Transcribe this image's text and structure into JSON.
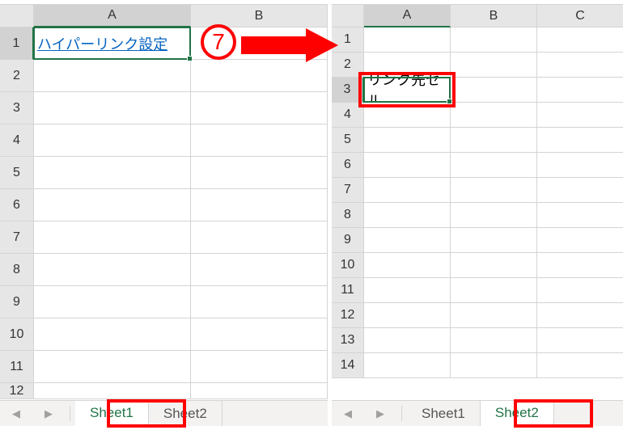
{
  "left": {
    "columns": [
      "A",
      "B"
    ],
    "rows": [
      "1",
      "2",
      "3",
      "4",
      "5",
      "6",
      "7",
      "8",
      "9",
      "10",
      "11",
      "12"
    ],
    "selected_row_idx": 0,
    "selected_col_idx": 0,
    "cells": {
      "r0c0": "ハイパーリンク設定"
    },
    "tabs": [
      {
        "label": "Sheet1",
        "active": true
      },
      {
        "label": "Sheet2",
        "active": false
      }
    ]
  },
  "right": {
    "columns": [
      "A",
      "B",
      "C"
    ],
    "rows": [
      "1",
      "2",
      "3",
      "4",
      "5",
      "6",
      "7",
      "8",
      "9",
      "10",
      "11",
      "12",
      "13",
      "14"
    ],
    "selected_row_idx": 2,
    "selected_col_idx": 0,
    "cells": {
      "r2c0": "リンク先セル"
    },
    "tabs": [
      {
        "label": "Sheet1",
        "active": false
      },
      {
        "label": "Sheet2",
        "active": true
      }
    ]
  },
  "step": {
    "number": "7"
  },
  "nav": {
    "left_glyph": "◀",
    "right_glyph": "▶"
  }
}
